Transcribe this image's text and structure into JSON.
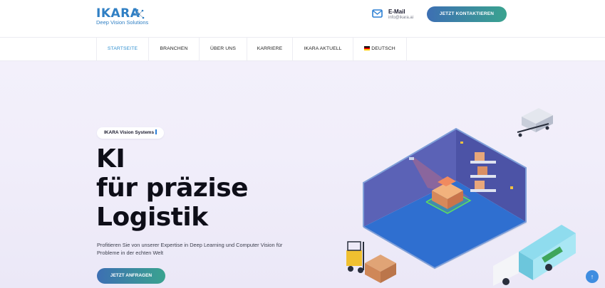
{
  "header": {
    "logo_word": "IKARA",
    "logo_tagline": "Deep Vision Solutions",
    "mail_title": "E-Mail",
    "mail_address": "info@ikara.ai",
    "cta_label": "JETZT KONTAKTIEREN"
  },
  "nav": {
    "items": [
      {
        "label": "STARTSEITE",
        "active": true
      },
      {
        "label": "BRANCHEN"
      },
      {
        "label": "ÜBER UNS"
      },
      {
        "label": "KARRIERE"
      },
      {
        "label": "IKARA AKTUELL"
      },
      {
        "label": "DEUTSCH",
        "icon": "german-flag-icon"
      }
    ]
  },
  "hero": {
    "badge": "IKARA Vision Systems",
    "headline": [
      "KI",
      "für präzise",
      "Logistik"
    ],
    "lead": "Profitieren Sie von unserer Expertise in Deep Learning und Computer Vision für Probleme in der echten Welt",
    "cta_label": "JETZT ANFRAGEN",
    "illustration_icon": "isometric-warehouse-illustration"
  },
  "scroll_top_icon": "arrow-up-icon",
  "colors": {
    "brand_blue": "#2f7fc4",
    "gradient_start": "#3d6fb3",
    "gradient_end": "#3aa38f",
    "active_nav": "#2f8fd0",
    "hero_bg": "#f1eefa"
  }
}
